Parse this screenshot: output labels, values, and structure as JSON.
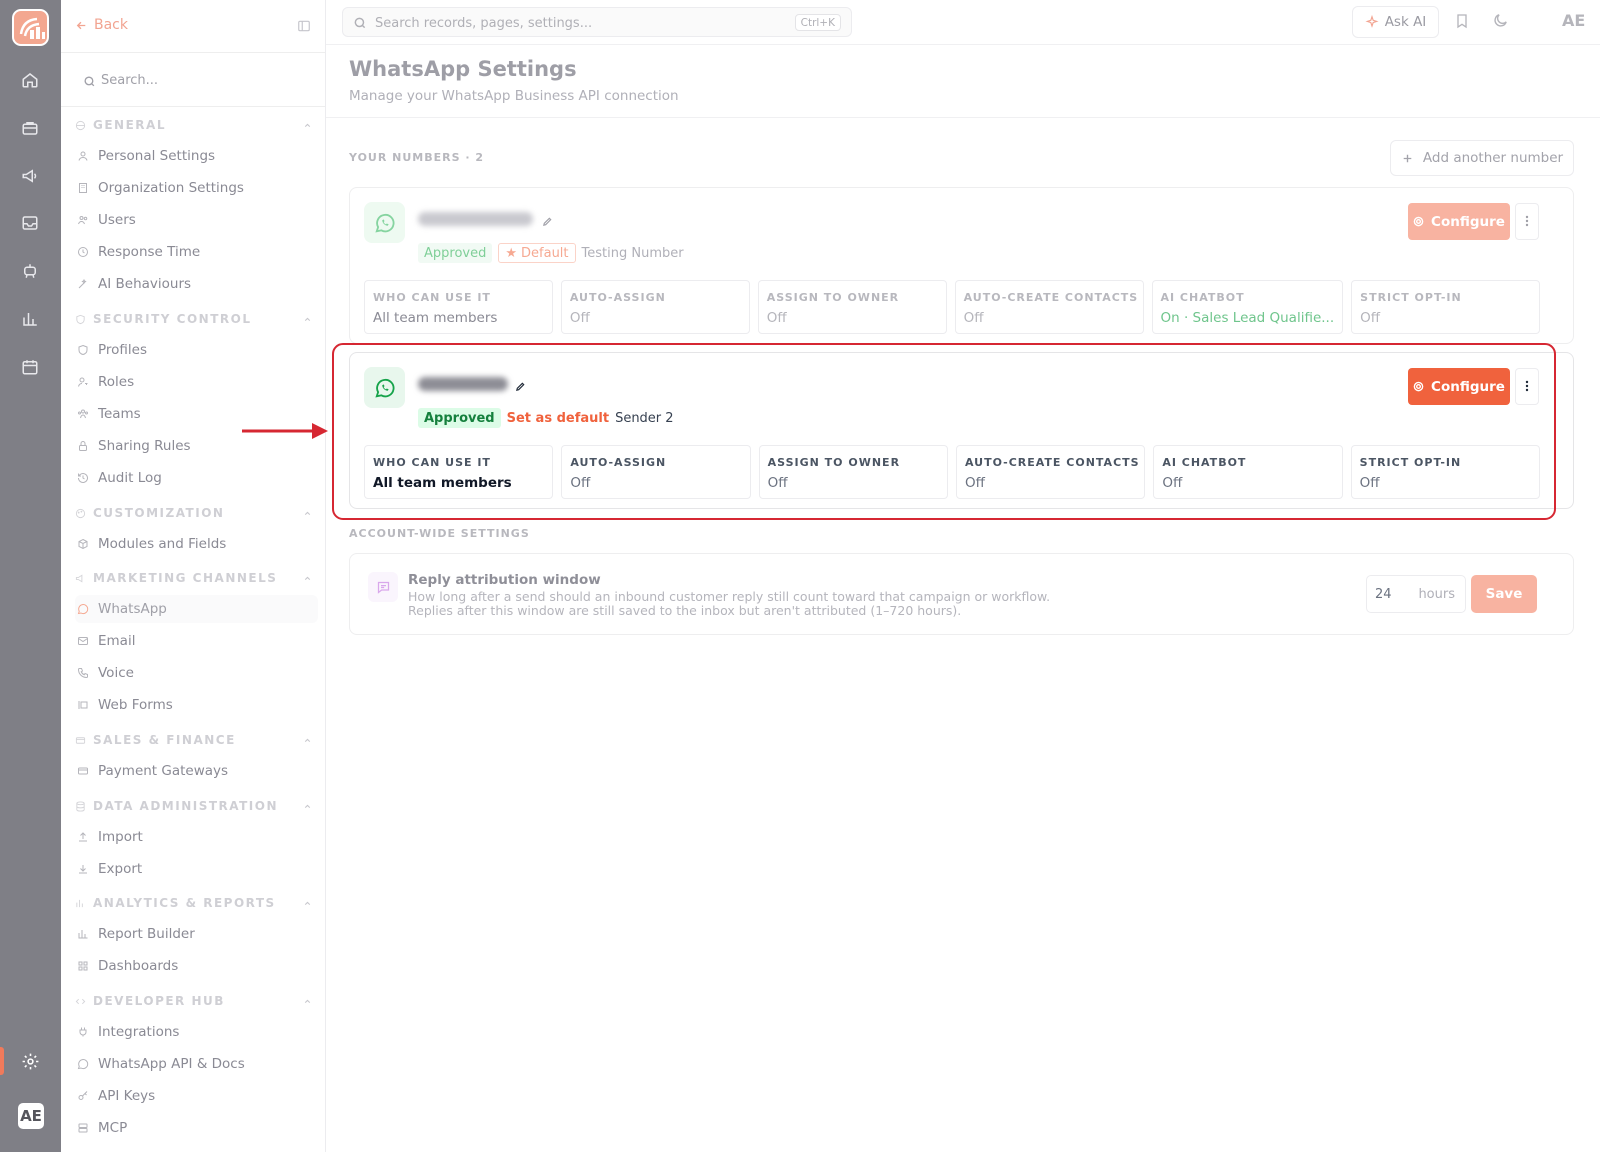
{
  "colors": {
    "accent": "#f0623d",
    "accent_faded": "#f8b3a1",
    "success": "#16a34a",
    "success_bg": "#dcfce7",
    "highlight": "#d62732"
  },
  "rail": {
    "icons": [
      "logo-icon",
      "home-icon",
      "briefcase-icon",
      "megaphone-icon",
      "inbox-icon",
      "robot-icon",
      "bar-chart-icon",
      "calendar-icon",
      "settings-icon"
    ],
    "avatar": "AE"
  },
  "sidebar": {
    "back_label": "Back",
    "search_placeholder": "Search...",
    "sections": [
      {
        "title": "GENERAL",
        "items": [
          "Personal Settings",
          "Organization Settings",
          "Users",
          "Response Time",
          "AI Behaviours"
        ]
      },
      {
        "title": "SECURITY CONTROL",
        "items": [
          "Profiles",
          "Roles",
          "Teams",
          "Sharing Rules",
          "Audit Log"
        ]
      },
      {
        "title": "CUSTOMIZATION",
        "items": [
          "Modules and Fields"
        ]
      },
      {
        "title": "MARKETING CHANNELS",
        "items": [
          "WhatsApp",
          "Email",
          "Voice",
          "Web Forms"
        ]
      },
      {
        "title": "SALES & FINANCE",
        "items": [
          "Payment Gateways"
        ]
      },
      {
        "title": "DATA ADMINISTRATION",
        "items": [
          "Import",
          "Export"
        ]
      },
      {
        "title": "ANALYTICS & REPORTS",
        "items": [
          "Report Builder",
          "Dashboards"
        ]
      },
      {
        "title": "DEVELOPER HUB",
        "items": [
          "Integrations",
          "WhatsApp API & Docs",
          "API Keys",
          "MCP"
        ]
      }
    ],
    "active_item": "WhatsApp"
  },
  "topbar": {
    "search_placeholder": "Search records, pages, settings...",
    "shortcut": "Ctrl+K",
    "ask_ai": "Ask AI",
    "user_initials": "AE"
  },
  "page": {
    "title": "WhatsApp Settings",
    "subtitle": "Manage your WhatsApp Business API connection",
    "numbers_label": "YOUR NUMBERS · 2",
    "add_number": "Add another number",
    "numbers": [
      {
        "status": "Approved",
        "default_badge": "Default",
        "name": "Testing Number",
        "configure": "Configure",
        "settings": [
          {
            "label": "WHO CAN USE IT",
            "value": "All team members"
          },
          {
            "label": "AUTO-ASSIGN",
            "value": "Off"
          },
          {
            "label": "ASSIGN TO OWNER",
            "value": "Off"
          },
          {
            "label": "AUTO-CREATE CONTACTS",
            "value": "Off"
          },
          {
            "label": "AI CHATBOT",
            "value": "On · Sales Lead Qualifie..."
          },
          {
            "label": "STRICT OPT-IN",
            "value": "Off"
          }
        ]
      },
      {
        "status": "Approved",
        "set_default": "Set as default",
        "name": "Sender 2",
        "configure": "Configure",
        "settings": [
          {
            "label": "WHO CAN USE IT",
            "value": "All team members"
          },
          {
            "label": "AUTO-ASSIGN",
            "value": "Off"
          },
          {
            "label": "ASSIGN TO OWNER",
            "value": "Off"
          },
          {
            "label": "AUTO-CREATE CONTACTS",
            "value": "Off"
          },
          {
            "label": "AI CHATBOT",
            "value": "Off"
          },
          {
            "label": "STRICT OPT-IN",
            "value": "Off"
          }
        ]
      }
    ],
    "account_label": "ACCOUNT-WIDE SETTINGS",
    "reply_window": {
      "title": "Reply attribution window",
      "description": "How long after a send should an inbound customer reply still count toward that campaign or workflow. Replies after this window are still saved to the inbox but aren't attributed (1–720 hours).",
      "value": "24",
      "unit": "hours",
      "save": "Save"
    }
  }
}
